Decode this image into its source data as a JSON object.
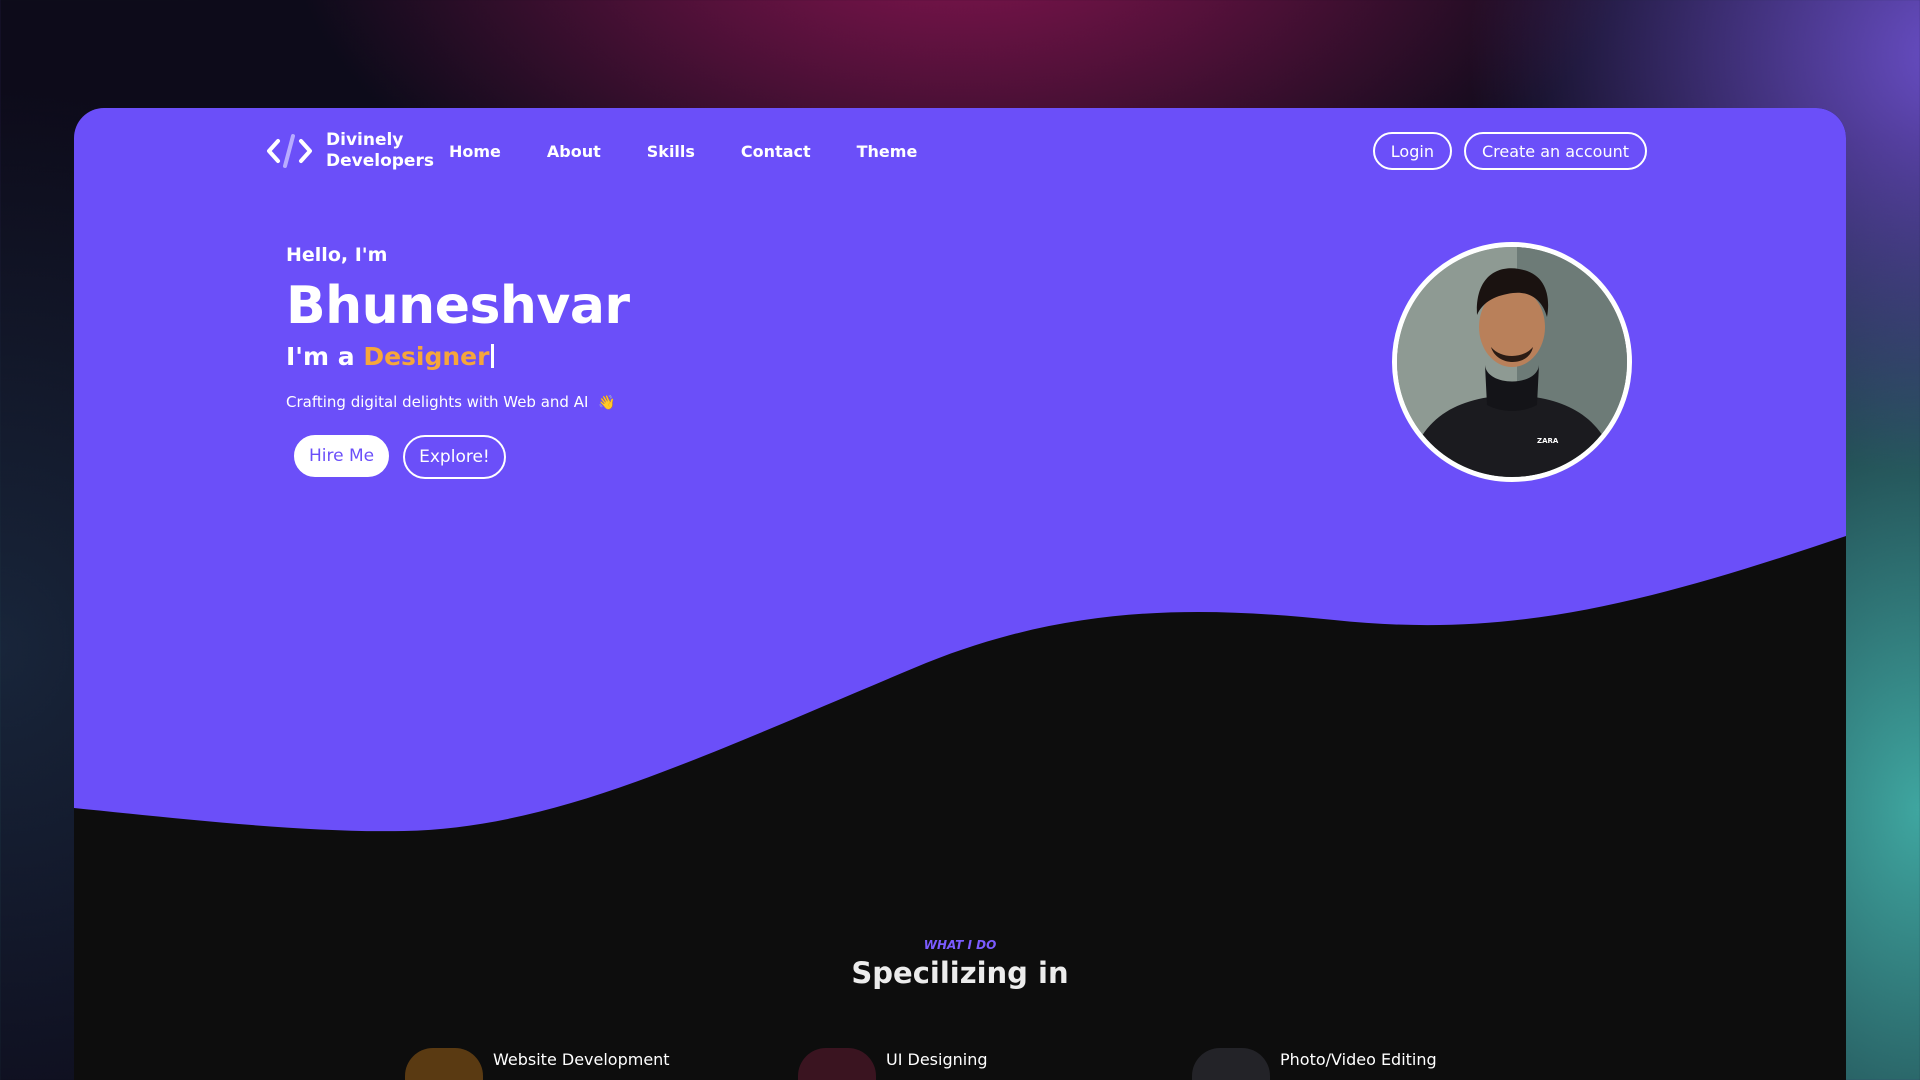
{
  "brand": {
    "line1": "Divinely",
    "line2": "Developers",
    "logo_icon": "code-brackets-icon"
  },
  "nav": {
    "items": [
      "Home",
      "About",
      "Skills",
      "Contact",
      "Theme"
    ]
  },
  "auth": {
    "login": "Login",
    "signup": "Create an account"
  },
  "hero": {
    "greeting": "Hello, I'm",
    "name": "Bhuneshvar",
    "role_prefix": "I'm a",
    "role": "Designer",
    "tagline": "Crafting digital delights with Web and AI",
    "tagline_emoji": "👋",
    "hire_button": "Hire Me",
    "explore_button": "Explore!",
    "avatar_shirt_text": "ZARA"
  },
  "services": {
    "eyebrow": "WHAT I DO",
    "title": "Specilizing in",
    "items": [
      {
        "label": "Website Development",
        "color": "#5a3a12"
      },
      {
        "label": "UI Designing",
        "color": "#3a1420"
      },
      {
        "label": "Photo/Video Editing",
        "color": "#232328"
      }
    ]
  },
  "colors": {
    "primary": "#6b4ff9",
    "accent": "#f6a63a",
    "dark": "#0d0d0d"
  }
}
